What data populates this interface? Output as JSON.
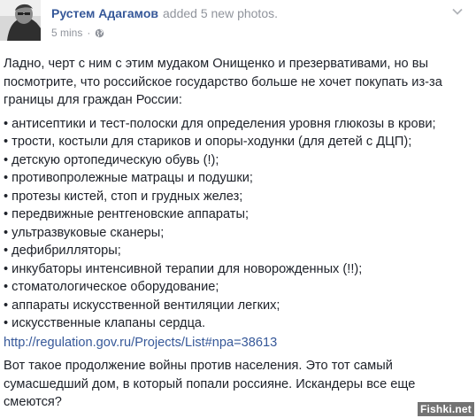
{
  "post": {
    "author": "Рустем Адагамов",
    "action": "added 5 new photos.",
    "time": "5 mins",
    "dot": "·",
    "intro": "Ладно, черт с ним с этим мудаком Онищенко и презервативами, но вы посмотрите, что российское государство больше не хочет покупать из-за границы для граждан России:",
    "items": [
      "• антисептики и тест-полоски для определения уровня глюкозы в крови;",
      "• трости, костыли для стариков и опоры-ходунки (для детей с ДЦП);",
      "• детскую ортопедическую обувь (!);",
      "• противопролежные матрацы и подушки;",
      "• протезы кистей, стоп и грудных желез;",
      "• передвижные рентгеновские аппараты;",
      "• ультразвуковые сканеры;",
      "• дефибрилляторы;",
      "• инкубаторы интенсивной терапии для новорожденных (!!);",
      "• стоматологическое оборудование;",
      "• аппараты искусственной вентиляции легких;",
      "• искусственные клапаны сердца."
    ],
    "link": "http://regulation.gov.ru/Projects/List#npa=38613",
    "outro": "Вот такое продолжение войны против населения. Это тот самый сумасшедший дом, в который попали россияне. Искандеры все еще смеются?"
  },
  "icons": {
    "avatar": "avatar-photo",
    "privacy": "globe-icon",
    "menu": "chevron-down-icon"
  },
  "colors": {
    "link": "#365899",
    "meta": "#90949c",
    "text": "#1d2129"
  },
  "watermark": "Fishki.net"
}
